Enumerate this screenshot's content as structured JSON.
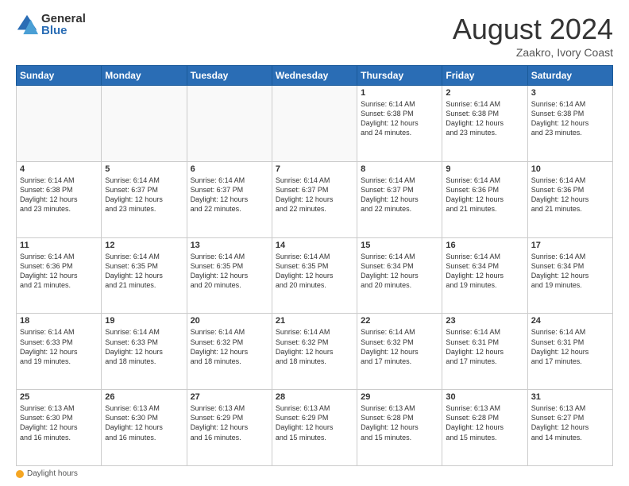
{
  "header": {
    "logo_general": "General",
    "logo_blue": "Blue",
    "month_title": "August 2024",
    "location": "Zaakro, Ivory Coast"
  },
  "days_of_week": [
    "Sunday",
    "Monday",
    "Tuesday",
    "Wednesday",
    "Thursday",
    "Friday",
    "Saturday"
  ],
  "footer": {
    "daylight_label": "Daylight hours"
  },
  "weeks": [
    [
      {
        "day": "",
        "info": ""
      },
      {
        "day": "",
        "info": ""
      },
      {
        "day": "",
        "info": ""
      },
      {
        "day": "",
        "info": ""
      },
      {
        "day": "1",
        "info": "Sunrise: 6:14 AM\nSunset: 6:38 PM\nDaylight: 12 hours\nand 24 minutes."
      },
      {
        "day": "2",
        "info": "Sunrise: 6:14 AM\nSunset: 6:38 PM\nDaylight: 12 hours\nand 23 minutes."
      },
      {
        "day": "3",
        "info": "Sunrise: 6:14 AM\nSunset: 6:38 PM\nDaylight: 12 hours\nand 23 minutes."
      }
    ],
    [
      {
        "day": "4",
        "info": "Sunrise: 6:14 AM\nSunset: 6:38 PM\nDaylight: 12 hours\nand 23 minutes."
      },
      {
        "day": "5",
        "info": "Sunrise: 6:14 AM\nSunset: 6:37 PM\nDaylight: 12 hours\nand 23 minutes."
      },
      {
        "day": "6",
        "info": "Sunrise: 6:14 AM\nSunset: 6:37 PM\nDaylight: 12 hours\nand 22 minutes."
      },
      {
        "day": "7",
        "info": "Sunrise: 6:14 AM\nSunset: 6:37 PM\nDaylight: 12 hours\nand 22 minutes."
      },
      {
        "day": "8",
        "info": "Sunrise: 6:14 AM\nSunset: 6:37 PM\nDaylight: 12 hours\nand 22 minutes."
      },
      {
        "day": "9",
        "info": "Sunrise: 6:14 AM\nSunset: 6:36 PM\nDaylight: 12 hours\nand 21 minutes."
      },
      {
        "day": "10",
        "info": "Sunrise: 6:14 AM\nSunset: 6:36 PM\nDaylight: 12 hours\nand 21 minutes."
      }
    ],
    [
      {
        "day": "11",
        "info": "Sunrise: 6:14 AM\nSunset: 6:36 PM\nDaylight: 12 hours\nand 21 minutes."
      },
      {
        "day": "12",
        "info": "Sunrise: 6:14 AM\nSunset: 6:35 PM\nDaylight: 12 hours\nand 21 minutes."
      },
      {
        "day": "13",
        "info": "Sunrise: 6:14 AM\nSunset: 6:35 PM\nDaylight: 12 hours\nand 20 minutes."
      },
      {
        "day": "14",
        "info": "Sunrise: 6:14 AM\nSunset: 6:35 PM\nDaylight: 12 hours\nand 20 minutes."
      },
      {
        "day": "15",
        "info": "Sunrise: 6:14 AM\nSunset: 6:34 PM\nDaylight: 12 hours\nand 20 minutes."
      },
      {
        "day": "16",
        "info": "Sunrise: 6:14 AM\nSunset: 6:34 PM\nDaylight: 12 hours\nand 19 minutes."
      },
      {
        "day": "17",
        "info": "Sunrise: 6:14 AM\nSunset: 6:34 PM\nDaylight: 12 hours\nand 19 minutes."
      }
    ],
    [
      {
        "day": "18",
        "info": "Sunrise: 6:14 AM\nSunset: 6:33 PM\nDaylight: 12 hours\nand 19 minutes."
      },
      {
        "day": "19",
        "info": "Sunrise: 6:14 AM\nSunset: 6:33 PM\nDaylight: 12 hours\nand 18 minutes."
      },
      {
        "day": "20",
        "info": "Sunrise: 6:14 AM\nSunset: 6:32 PM\nDaylight: 12 hours\nand 18 minutes."
      },
      {
        "day": "21",
        "info": "Sunrise: 6:14 AM\nSunset: 6:32 PM\nDaylight: 12 hours\nand 18 minutes."
      },
      {
        "day": "22",
        "info": "Sunrise: 6:14 AM\nSunset: 6:32 PM\nDaylight: 12 hours\nand 17 minutes."
      },
      {
        "day": "23",
        "info": "Sunrise: 6:14 AM\nSunset: 6:31 PM\nDaylight: 12 hours\nand 17 minutes."
      },
      {
        "day": "24",
        "info": "Sunrise: 6:14 AM\nSunset: 6:31 PM\nDaylight: 12 hours\nand 17 minutes."
      }
    ],
    [
      {
        "day": "25",
        "info": "Sunrise: 6:13 AM\nSunset: 6:30 PM\nDaylight: 12 hours\nand 16 minutes."
      },
      {
        "day": "26",
        "info": "Sunrise: 6:13 AM\nSunset: 6:30 PM\nDaylight: 12 hours\nand 16 minutes."
      },
      {
        "day": "27",
        "info": "Sunrise: 6:13 AM\nSunset: 6:29 PM\nDaylight: 12 hours\nand 16 minutes."
      },
      {
        "day": "28",
        "info": "Sunrise: 6:13 AM\nSunset: 6:29 PM\nDaylight: 12 hours\nand 15 minutes."
      },
      {
        "day": "29",
        "info": "Sunrise: 6:13 AM\nSunset: 6:28 PM\nDaylight: 12 hours\nand 15 minutes."
      },
      {
        "day": "30",
        "info": "Sunrise: 6:13 AM\nSunset: 6:28 PM\nDaylight: 12 hours\nand 15 minutes."
      },
      {
        "day": "31",
        "info": "Sunrise: 6:13 AM\nSunset: 6:27 PM\nDaylight: 12 hours\nand 14 minutes."
      }
    ]
  ]
}
